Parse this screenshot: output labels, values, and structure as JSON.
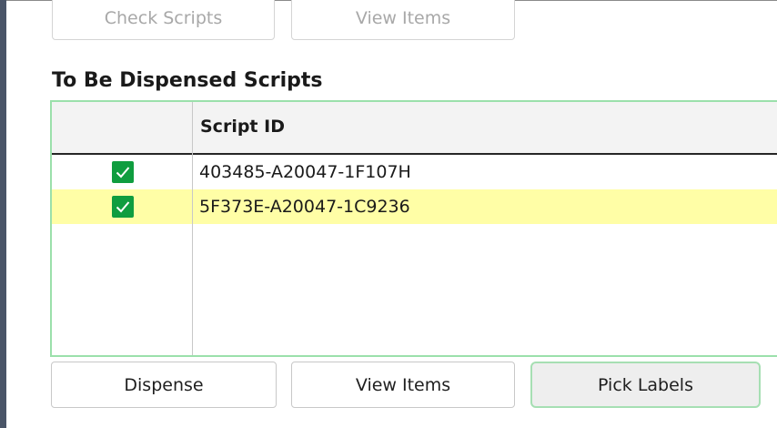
{
  "top_actions": {
    "check_scripts_label": "Check Scripts",
    "view_items_label": "View Items"
  },
  "section": {
    "title": "To Be Dispensed Scripts"
  },
  "grid": {
    "column_header": "Script ID",
    "rows": [
      {
        "checked": true,
        "script_id": "403485-A20047-1F107H"
      },
      {
        "checked": true,
        "script_id": "5F373E-A20047-1C9236"
      }
    ]
  },
  "bottom_actions": {
    "dispense_label": "Dispense",
    "view_items_label": "View Items",
    "pick_labels_label": "Pick Labels"
  },
  "colors": {
    "checkbox_green": "#0f9d3f",
    "selected_row": "#fffea6",
    "grid_border": "#9be0ab",
    "window_edge": "#4a5568"
  }
}
